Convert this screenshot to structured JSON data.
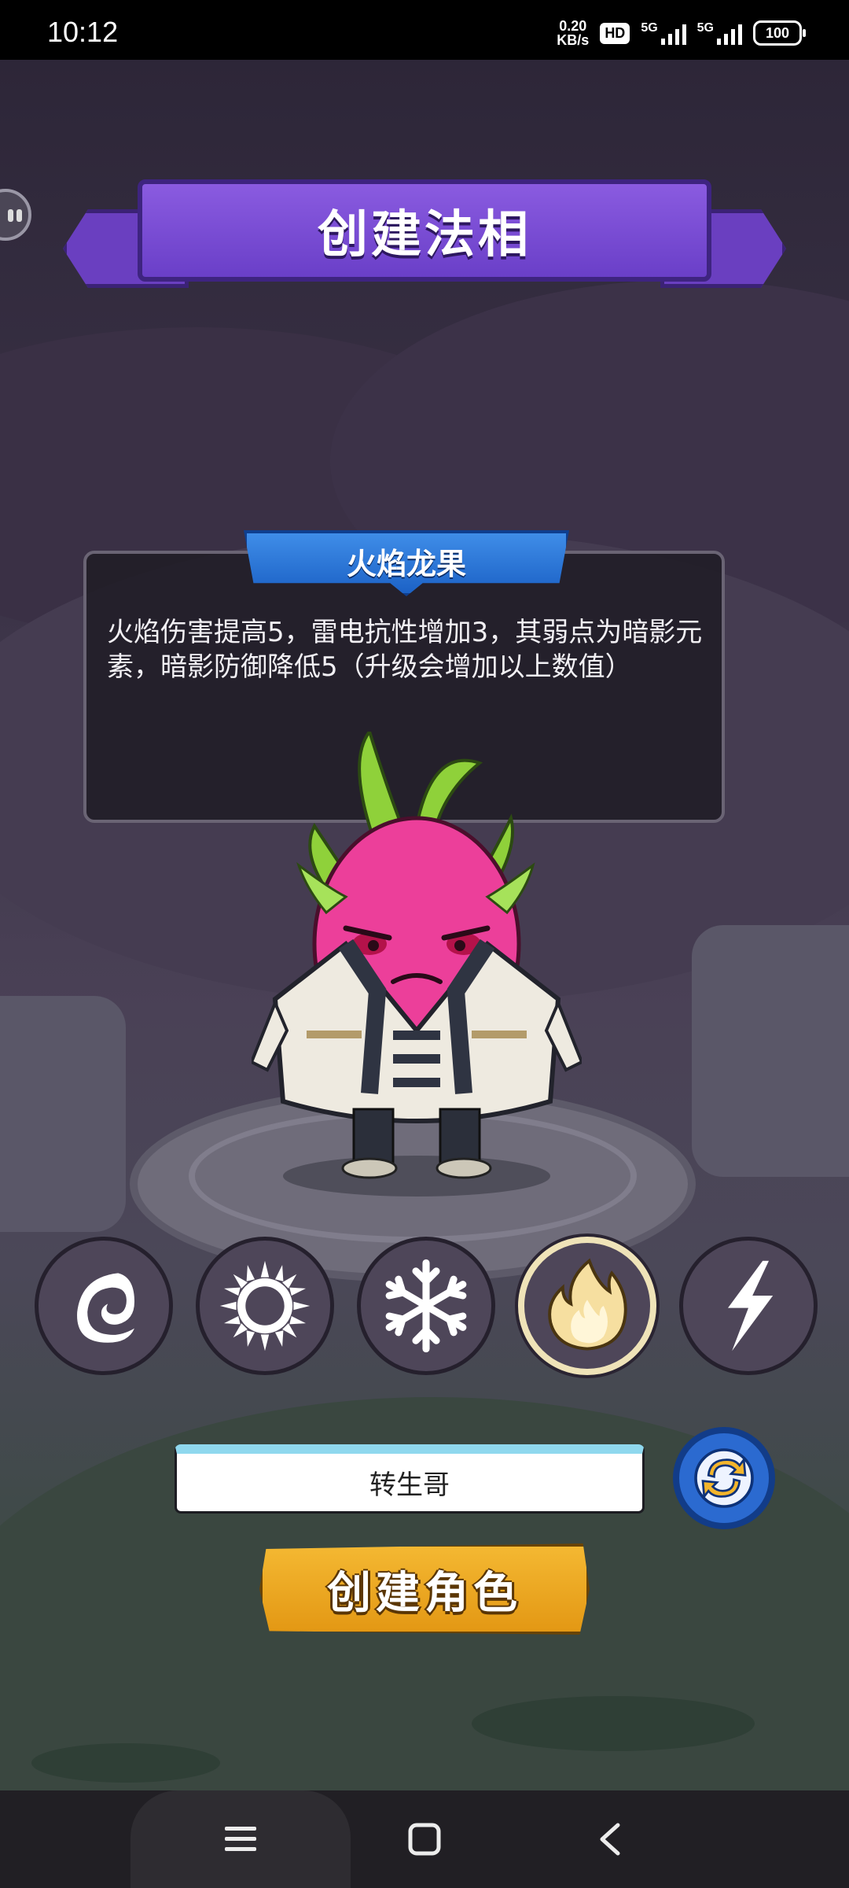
{
  "status_bar": {
    "time": "10:12",
    "net_speed_value": "0.20",
    "net_speed_unit": "KB/s",
    "hd_badge": "HD",
    "signal1_label": "5G",
    "signal2_label": "5G",
    "battery": "100"
  },
  "header": {
    "title": "创建法相"
  },
  "info": {
    "title": "火焰龙果",
    "description": "火焰伤害提高5，雷电抗性增加3，其弱点为暗影元素，暗影防御降低5（升级会增加以上数值）"
  },
  "elements": {
    "selected_index": 3,
    "items": [
      {
        "name": "shadow",
        "icon": "crescent-swirl-icon"
      },
      {
        "name": "light",
        "icon": "sun-ring-icon"
      },
      {
        "name": "ice",
        "icon": "snowflake-icon"
      },
      {
        "name": "fire",
        "icon": "flame-icon"
      },
      {
        "name": "thunder",
        "icon": "lightning-icon"
      }
    ]
  },
  "name_input": {
    "value": "转生哥"
  },
  "create_button": {
    "label": "创建角色"
  },
  "colors": {
    "banner": "#6a3fc8",
    "info_ribbon": "#1c62c6",
    "create_button": "#f0ab22",
    "selected_ring": "#efe3b8"
  }
}
